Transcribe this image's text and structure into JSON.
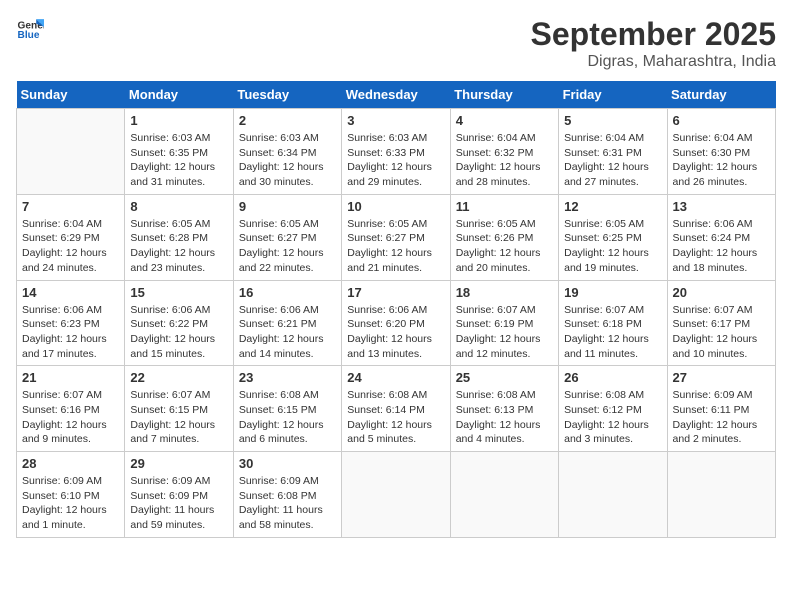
{
  "logo": {
    "text_general": "General",
    "text_blue": "Blue"
  },
  "header": {
    "month": "September 2025",
    "location": "Digras, Maharashtra, India"
  },
  "weekdays": [
    "Sunday",
    "Monday",
    "Tuesday",
    "Wednesday",
    "Thursday",
    "Friday",
    "Saturday"
  ],
  "weeks": [
    [
      {
        "day": "",
        "empty": true
      },
      {
        "day": "1",
        "sunrise": "6:03 AM",
        "sunset": "6:35 PM",
        "daylight": "12 hours and 31 minutes."
      },
      {
        "day": "2",
        "sunrise": "6:03 AM",
        "sunset": "6:34 PM",
        "daylight": "12 hours and 30 minutes."
      },
      {
        "day": "3",
        "sunrise": "6:03 AM",
        "sunset": "6:33 PM",
        "daylight": "12 hours and 29 minutes."
      },
      {
        "day": "4",
        "sunrise": "6:04 AM",
        "sunset": "6:32 PM",
        "daylight": "12 hours and 28 minutes."
      },
      {
        "day": "5",
        "sunrise": "6:04 AM",
        "sunset": "6:31 PM",
        "daylight": "12 hours and 27 minutes."
      },
      {
        "day": "6",
        "sunrise": "6:04 AM",
        "sunset": "6:30 PM",
        "daylight": "12 hours and 26 minutes."
      }
    ],
    [
      {
        "day": "7",
        "sunrise": "6:04 AM",
        "sunset": "6:29 PM",
        "daylight": "12 hours and 24 minutes."
      },
      {
        "day": "8",
        "sunrise": "6:05 AM",
        "sunset": "6:28 PM",
        "daylight": "12 hours and 23 minutes."
      },
      {
        "day": "9",
        "sunrise": "6:05 AM",
        "sunset": "6:27 PM",
        "daylight": "12 hours and 22 minutes."
      },
      {
        "day": "10",
        "sunrise": "6:05 AM",
        "sunset": "6:27 PM",
        "daylight": "12 hours and 21 minutes."
      },
      {
        "day": "11",
        "sunrise": "6:05 AM",
        "sunset": "6:26 PM",
        "daylight": "12 hours and 20 minutes."
      },
      {
        "day": "12",
        "sunrise": "6:05 AM",
        "sunset": "6:25 PM",
        "daylight": "12 hours and 19 minutes."
      },
      {
        "day": "13",
        "sunrise": "6:06 AM",
        "sunset": "6:24 PM",
        "daylight": "12 hours and 18 minutes."
      }
    ],
    [
      {
        "day": "14",
        "sunrise": "6:06 AM",
        "sunset": "6:23 PM",
        "daylight": "12 hours and 17 minutes."
      },
      {
        "day": "15",
        "sunrise": "6:06 AM",
        "sunset": "6:22 PM",
        "daylight": "12 hours and 15 minutes."
      },
      {
        "day": "16",
        "sunrise": "6:06 AM",
        "sunset": "6:21 PM",
        "daylight": "12 hours and 14 minutes."
      },
      {
        "day": "17",
        "sunrise": "6:06 AM",
        "sunset": "6:20 PM",
        "daylight": "12 hours and 13 minutes."
      },
      {
        "day": "18",
        "sunrise": "6:07 AM",
        "sunset": "6:19 PM",
        "daylight": "12 hours and 12 minutes."
      },
      {
        "day": "19",
        "sunrise": "6:07 AM",
        "sunset": "6:18 PM",
        "daylight": "12 hours and 11 minutes."
      },
      {
        "day": "20",
        "sunrise": "6:07 AM",
        "sunset": "6:17 PM",
        "daylight": "12 hours and 10 minutes."
      }
    ],
    [
      {
        "day": "21",
        "sunrise": "6:07 AM",
        "sunset": "6:16 PM",
        "daylight": "12 hours and 9 minutes."
      },
      {
        "day": "22",
        "sunrise": "6:07 AM",
        "sunset": "6:15 PM",
        "daylight": "12 hours and 7 minutes."
      },
      {
        "day": "23",
        "sunrise": "6:08 AM",
        "sunset": "6:15 PM",
        "daylight": "12 hours and 6 minutes."
      },
      {
        "day": "24",
        "sunrise": "6:08 AM",
        "sunset": "6:14 PM",
        "daylight": "12 hours and 5 minutes."
      },
      {
        "day": "25",
        "sunrise": "6:08 AM",
        "sunset": "6:13 PM",
        "daylight": "12 hours and 4 minutes."
      },
      {
        "day": "26",
        "sunrise": "6:08 AM",
        "sunset": "6:12 PM",
        "daylight": "12 hours and 3 minutes."
      },
      {
        "day": "27",
        "sunrise": "6:09 AM",
        "sunset": "6:11 PM",
        "daylight": "12 hours and 2 minutes."
      }
    ],
    [
      {
        "day": "28",
        "sunrise": "6:09 AM",
        "sunset": "6:10 PM",
        "daylight": "12 hours and 1 minute."
      },
      {
        "day": "29",
        "sunrise": "6:09 AM",
        "sunset": "6:09 PM",
        "daylight": "11 hours and 59 minutes."
      },
      {
        "day": "30",
        "sunrise": "6:09 AM",
        "sunset": "6:08 PM",
        "daylight": "11 hours and 58 minutes."
      },
      {
        "day": "",
        "empty": true
      },
      {
        "day": "",
        "empty": true
      },
      {
        "day": "",
        "empty": true
      },
      {
        "day": "",
        "empty": true
      }
    ]
  ]
}
